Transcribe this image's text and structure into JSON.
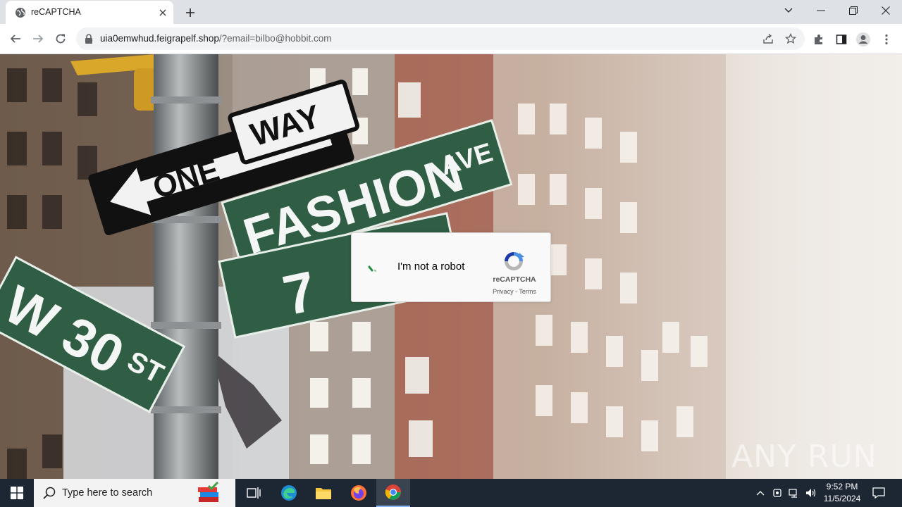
{
  "browser": {
    "tab": {
      "title": "reCAPTCHA",
      "favicon": "globe-icon",
      "close_icon": "close-icon"
    },
    "new_tab_icon": "plus-icon",
    "window_controls": [
      "chevron-down-icon",
      "minimize-icon",
      "restore-icon",
      "close-icon"
    ],
    "address": {
      "host": "uia0emwhud.feigrapelf.shop",
      "path": "/?email=bilbo@hobbit.com",
      "lock_icon": "lock-icon"
    },
    "nav_icons": [
      "back-arrow-icon",
      "forward-arrow-icon",
      "reload-icon"
    ],
    "omnibox_icons": [
      "share-icon",
      "star-icon"
    ],
    "toolbar_icons": [
      "extensions-icon",
      "side-panel-icon",
      "profile-icon",
      "more-icon"
    ]
  },
  "page": {
    "signs": {
      "way": "WAY",
      "one": "ONE",
      "fashion": "FASHION",
      "ave": "AVE",
      "seventh": "7",
      "w30": "W 30",
      "st": "ST"
    },
    "captcha": {
      "label": "I'm not a robot",
      "brand": "reCAPTCHA",
      "privacy": "Privacy",
      "separator": " - ",
      "terms": "Terms",
      "state": "loading"
    },
    "watermark": {
      "text": "ANY RUN"
    }
  },
  "taskbar": {
    "search_placeholder": "Type here to search",
    "apps": [
      "task-view-icon",
      "edge-icon",
      "file-explorer-icon",
      "firefox-icon",
      "chrome-icon"
    ],
    "active_app": "chrome-icon",
    "tray_icons": [
      "chevron-up-icon",
      "meet-now-icon",
      "network-icon",
      "volume-icon"
    ],
    "time": "9:52 PM",
    "date": "11/5/2024",
    "notification_icon": "notification-icon"
  },
  "colors": {
    "tabstrip": "#dee1e6",
    "taskbar": "#1d2633",
    "sign_green": "#2f5e44",
    "captcha_blue": "#4a90e2",
    "spinner_green": "#1e8e3e"
  }
}
